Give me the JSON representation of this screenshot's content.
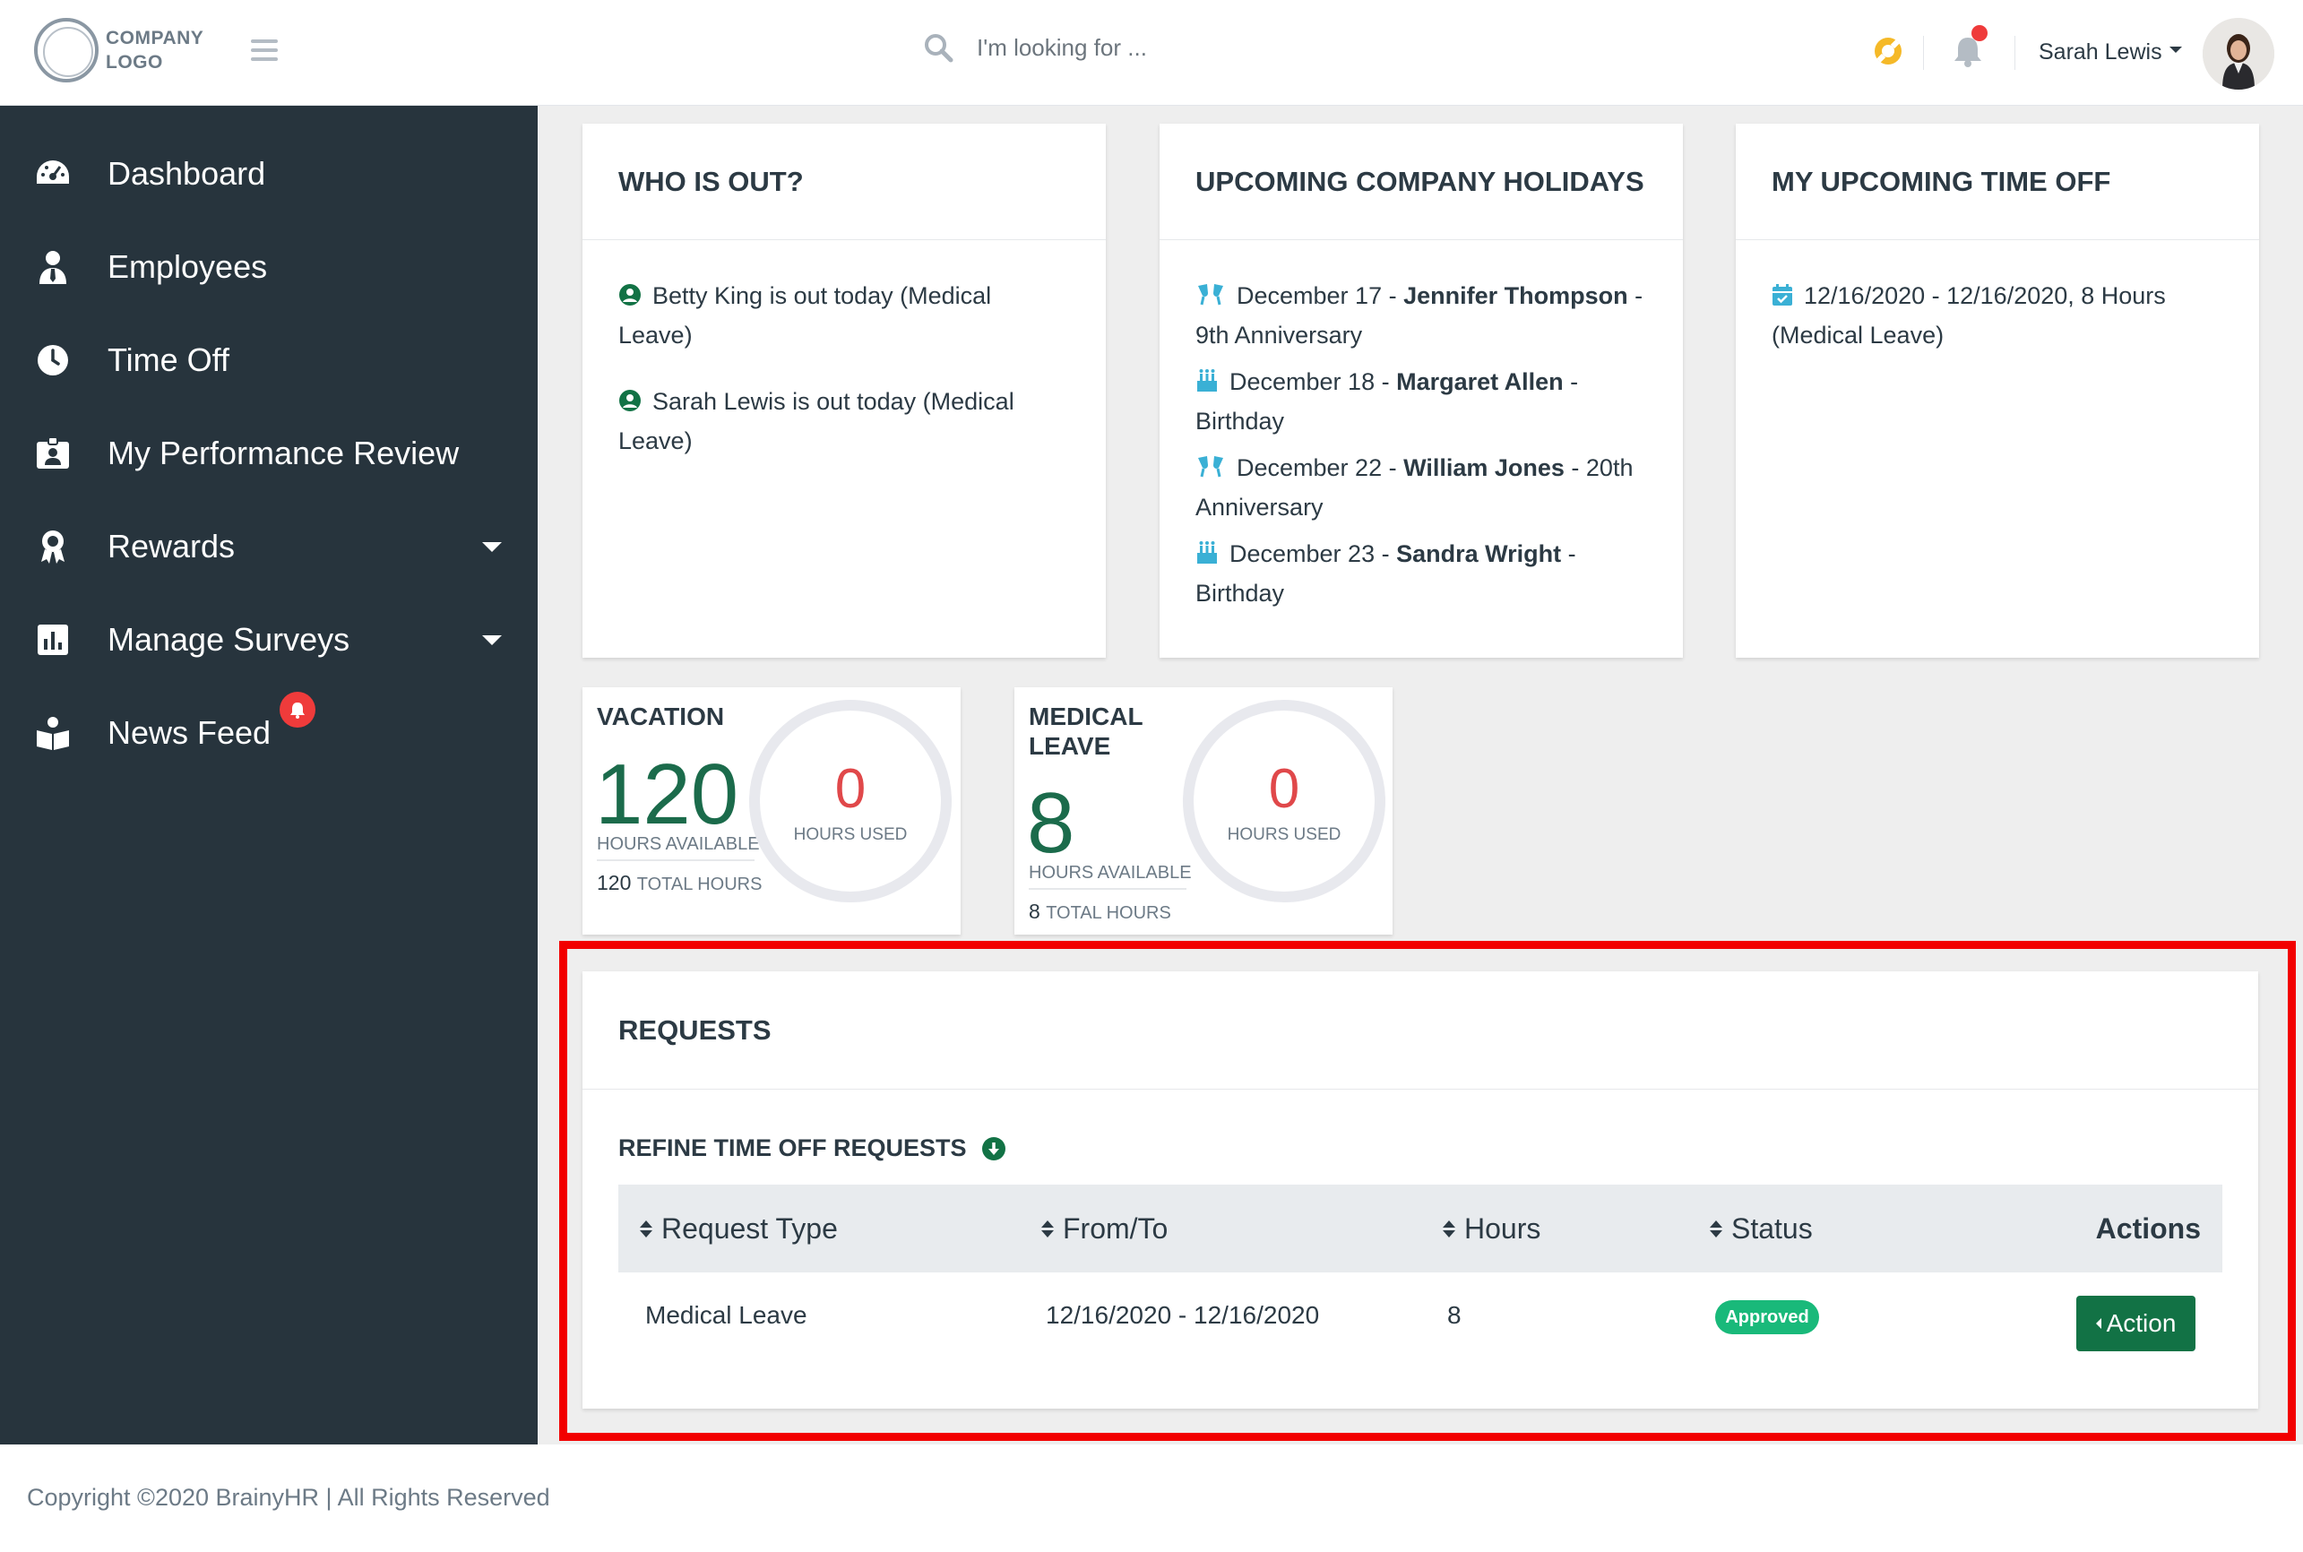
{
  "header": {
    "logo_line1": "COMPANY",
    "logo_line2": "LOGO",
    "search_placeholder": "I'm looking for ...",
    "user_name": "Sarah Lewis"
  },
  "sidebar": {
    "items": [
      {
        "label": "Dashboard",
        "icon": "tachometer-icon"
      },
      {
        "label": "Employees",
        "icon": "user-tie-icon"
      },
      {
        "label": "Time Off",
        "icon": "clock-icon"
      },
      {
        "label": "My Performance Review",
        "icon": "id-badge-icon"
      },
      {
        "label": "Rewards",
        "icon": "award-icon",
        "has_dropdown": true
      },
      {
        "label": "Manage Surveys",
        "icon": "poll-icon",
        "has_dropdown": true
      },
      {
        "label": "News Feed",
        "icon": "reader-icon",
        "badge": "bell-icon"
      }
    ]
  },
  "who_is_out": {
    "title": "WHO IS OUT?",
    "entries": [
      "Betty King is out today (Medical Leave)",
      "Sarah Lewis is out today (Medical Leave)"
    ]
  },
  "holidays": {
    "title": "UPCOMING COMPANY HOLIDAYS",
    "items": [
      {
        "date": "December 17",
        "name": "Jennifer Thompson",
        "event": "9th Anniversary",
        "icon": "glass-cheers-icon"
      },
      {
        "date": "December 18",
        "name": "Margaret Allen",
        "event": "Birthday",
        "icon": "birthday-cake-icon"
      },
      {
        "date": "December 22",
        "name": "William Jones",
        "event": "20th Anniversary",
        "icon": "glass-cheers-icon"
      },
      {
        "date": "December 23",
        "name": "Sandra Wright",
        "event": "Birthday",
        "icon": "birthday-cake-icon"
      }
    ]
  },
  "my_time_off": {
    "title": "MY UPCOMING TIME OFF",
    "entries": [
      "12/16/2020 - 12/16/2020, 8 Hours (Medical Leave)"
    ]
  },
  "leave_widgets": [
    {
      "title_line1": "VACATION",
      "title_line2": "",
      "available": "120",
      "available_label": "HOURS AVAILABLE",
      "total": "120",
      "total_label": "TOTAL HOURS",
      "used": "0",
      "used_label": "HOURS USED"
    },
    {
      "title_line1": "MEDICAL",
      "title_line2": "LEAVE",
      "available": "8",
      "available_label": "HOURS AVAILABLE",
      "total": "8",
      "total_label": "TOTAL HOURS",
      "used": "0",
      "used_label": "HOURS USED"
    }
  ],
  "requests": {
    "title": "REQUESTS",
    "refine_label": "REFINE TIME OFF REQUESTS",
    "columns": [
      "Request Type",
      "From/To",
      "Hours",
      "Status",
      "Actions"
    ],
    "rows": [
      {
        "type": "Medical Leave",
        "from_to": "12/16/2020 - 12/16/2020",
        "hours": "8",
        "status": "Approved",
        "action_label": "Action"
      }
    ]
  },
  "footer": {
    "copyright": "Copyright ©2020 BrainyHR | All Rights Reserved"
  },
  "colors": {
    "sidebar_bg": "#27343d",
    "main_bg": "#eeeeee",
    "accent_green": "#127245",
    "big_number_green": "#1b6b4b",
    "used_red": "#e0484a",
    "approved_badge": "#19b97a",
    "icon_teal": "#3ab0d5",
    "highlight_red": "#f20000",
    "notification_red": "#ef3b3b"
  }
}
